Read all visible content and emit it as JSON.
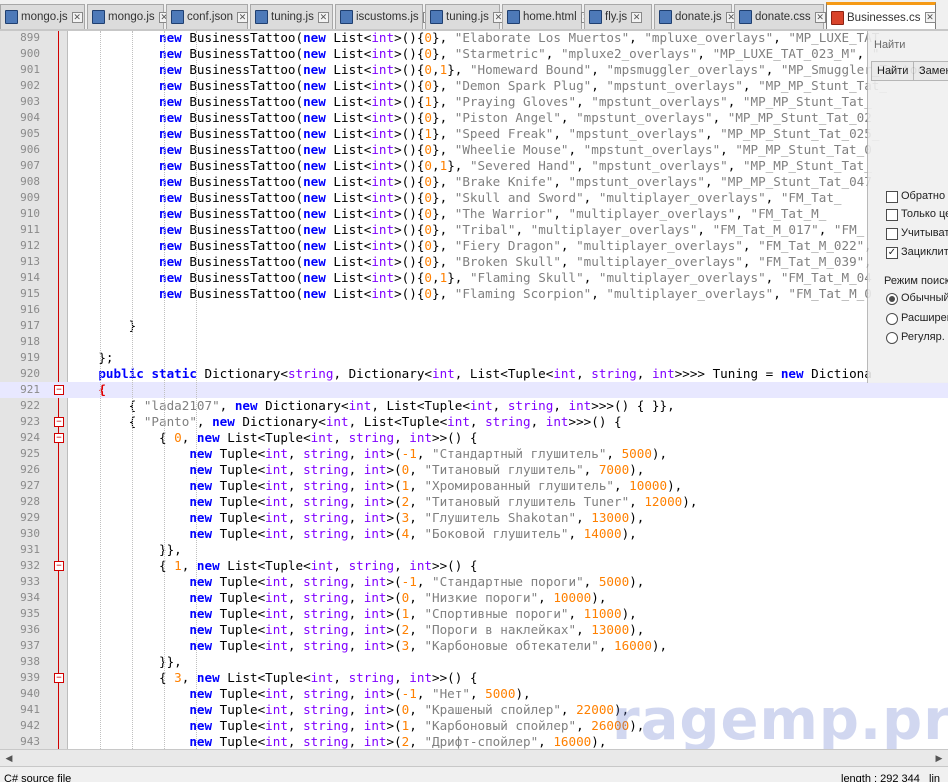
{
  "tabs": [
    {
      "label": "mongo.js",
      "active": false
    },
    {
      "label": "mongo.js",
      "active": false
    },
    {
      "label": "conf.json",
      "active": false
    },
    {
      "label": "tuning.js",
      "active": false
    },
    {
      "label": "iscustoms.js",
      "active": false
    },
    {
      "label": "tuning.js",
      "active": false
    },
    {
      "label": "home.html",
      "active": false
    },
    {
      "label": "fly.js",
      "active": false
    },
    {
      "label": "donate.js",
      "active": false
    },
    {
      "label": "donate.css",
      "active": false
    },
    {
      "label": "Businesses.cs",
      "active": true
    }
  ],
  "tab_close_glyph": "✕",
  "code_lines": [
    {
      "n": "899",
      "text": "            new BusinessTattoo(new List<int>(){0}, \"Elaborate Los Muertos\", \"mpluxe_overlays\", \"MP_LUXE_TAT"
    },
    {
      "n": "900",
      "text": "            new BusinessTattoo(new List<int>(){0}, \"Starmetric\", \"mpluxe2_overlays\", \"MP_LUXE_TAT_023_M\", \""
    },
    {
      "n": "901",
      "text": "            new BusinessTattoo(new List<int>(){0,1}, \"Homeward Bound\", \"mpsmuggler_overlays\", \"MP_Smuggler_Tattoo"
    },
    {
      "n": "902",
      "text": "            new BusinessTattoo(new List<int>(){0}, \"Demon Spark Plug\", \"mpstunt_overlays\", \"MP_MP_Stunt_Tat_"
    },
    {
      "n": "903",
      "text": "            new BusinessTattoo(new List<int>(){1}, \"Praying Gloves\", \"mpstunt_overlays\", \"MP_MP_Stunt_Tat_"
    },
    {
      "n": "904",
      "text": "            new BusinessTattoo(new List<int>(){0}, \"Piston Angel\", \"mpstunt_overlays\", \"MP_MP_Stunt_Tat_02"
    },
    {
      "n": "905",
      "text": "            new BusinessTattoo(new List<int>(){1}, \"Speed Freak\", \"mpstunt_overlays\", \"MP_MP_Stunt_Tat_025_"
    },
    {
      "n": "906",
      "text": "            new BusinessTattoo(new List<int>(){0}, \"Wheelie Mouse\", \"mpstunt_overlays\", \"MP_MP_Stunt_Tat_0"
    },
    {
      "n": "907",
      "text": "            new BusinessTattoo(new List<int>(){0,1}, \"Severed Hand\", \"mpstunt_overlays\", \"MP_MP_Stunt_Tat_"
    },
    {
      "n": "908",
      "text": "            new BusinessTattoo(new List<int>(){0}, \"Brake Knife\", \"mpstunt_overlays\", \"MP_MP_Stunt_Tat_047"
    },
    {
      "n": "909",
      "text": "            new BusinessTattoo(new List<int>(){0}, \"Skull and Sword\", \"multiplayer_overlays\", \"FM_Tat_"
    },
    {
      "n": "910",
      "text": "            new BusinessTattoo(new List<int>(){0}, \"The Warrior\", \"multiplayer_overlays\", \"FM_Tat_M_"
    },
    {
      "n": "911",
      "text": "            new BusinessTattoo(new List<int>(){0}, \"Tribal\", \"multiplayer_overlays\", \"FM_Tat_M_017\", \"FM_"
    },
    {
      "n": "912",
      "text": "            new BusinessTattoo(new List<int>(){0}, \"Fiery Dragon\", \"multiplayer_overlays\", \"FM_Tat_M_022\","
    },
    {
      "n": "913",
      "text": "            new BusinessTattoo(new List<int>(){0}, \"Broken Skull\", \"multiplayer_overlays\", \"FM_Tat_M_039\","
    },
    {
      "n": "914",
      "text": "            new BusinessTattoo(new List<int>(){0,1}, \"Flaming Skull\", \"multiplayer_overlays\", \"FM_Tat_M_04"
    },
    {
      "n": "915",
      "text": "            new BusinessTattoo(new List<int>(){0}, \"Flaming Scorpion\", \"multiplayer_overlays\", \"FM_Tat_M_0"
    },
    {
      "n": "916",
      "text": ""
    },
    {
      "n": "917",
      "text": "        }"
    },
    {
      "n": "918",
      "text": ""
    },
    {
      "n": "919",
      "text": "    };"
    },
    {
      "n": "920",
      "text": "    public static Dictionary<string, Dictionary<int, List<Tuple<int, string, int>>>> Tuning = new Dictiona"
    },
    {
      "n": "921",
      "text": "    {"
    },
    {
      "n": "922",
      "text": "        { \"lada2107\", new Dictionary<int, List<Tuple<int, string, int>>>() { }},"
    },
    {
      "n": "923",
      "text": "        { \"Panto\", new Dictionary<int, List<Tuple<int, string, int>>>() {"
    },
    {
      "n": "924",
      "text": "            { 0, new List<Tuple<int, string, int>>() {"
    },
    {
      "n": "925",
      "text": "                new Tuple<int, string, int>(-1, \"Стандартный глушитель\", 5000),"
    },
    {
      "n": "926",
      "text": "                new Tuple<int, string, int>(0, \"Титановый глушитель\", 7000),"
    },
    {
      "n": "927",
      "text": "                new Tuple<int, string, int>(1, \"Хромированный глушитель\", 10000),"
    },
    {
      "n": "928",
      "text": "                new Tuple<int, string, int>(2, \"Титановый глушитель Tuner\", 12000),"
    },
    {
      "n": "929",
      "text": "                new Tuple<int, string, int>(3, \"Глушитель Shakotan\", 13000),"
    },
    {
      "n": "930",
      "text": "                new Tuple<int, string, int>(4, \"Боковой глушитель\", 14000),"
    },
    {
      "n": "931",
      "text": "            }},"
    },
    {
      "n": "932",
      "text": "            { 1, new List<Tuple<int, string, int>>() {"
    },
    {
      "n": "933",
      "text": "                new Tuple<int, string, int>(-1, \"Стандартные пороги\", 5000),"
    },
    {
      "n": "934",
      "text": "                new Tuple<int, string, int>(0, \"Низкие пороги\", 10000),"
    },
    {
      "n": "935",
      "text": "                new Tuple<int, string, int>(1, \"Спортивные пороги\", 11000),"
    },
    {
      "n": "936",
      "text": "                new Tuple<int, string, int>(2, \"Пороги в наклейках\", 13000),"
    },
    {
      "n": "937",
      "text": "                new Tuple<int, string, int>(3, \"Карбоновые обтекатели\", 16000),"
    },
    {
      "n": "938",
      "text": "            }},"
    },
    {
      "n": "939",
      "text": "            { 3, new List<Tuple<int, string, int>>() {"
    },
    {
      "n": "940",
      "text": "                new Tuple<int, string, int>(-1, \"Нет\", 5000),"
    },
    {
      "n": "941",
      "text": "                new Tuple<int, string, int>(0, \"Крашеный спойлер\", 22000),"
    },
    {
      "n": "942",
      "text": "                new Tuple<int, string, int>(1, \"Карбоновый спойлер\", 26000),"
    },
    {
      "n": "943",
      "text": "                new Tuple<int, string, int>(2, \"Дрифт-спойлер\", 16000),"
    }
  ],
  "current_line": "921",
  "fold_markers": [
    "921",
    "923",
    "924",
    "932",
    "939"
  ],
  "find_panel": {
    "find_label": "Найти",
    "find_button": "Найти",
    "replace_button": "Замен",
    "checkboxes": [
      {
        "label": "Обратно",
        "checked": false
      },
      {
        "label": "Только це",
        "checked": false
      },
      {
        "label": "Учитыват",
        "checked": false
      },
      {
        "label": "Зациклит",
        "checked": true
      }
    ],
    "search_mode_label": "Режим поиск",
    "radios": [
      {
        "label": "Обычный",
        "checked": true
      },
      {
        "label": "Расширен",
        "checked": false
      },
      {
        "label": "Регуляр.",
        "checked": false
      }
    ]
  },
  "status": {
    "file_type": "C# source file",
    "length": "length : 292 344",
    "lines": "lin"
  },
  "watermark": "ragemp.pro",
  "icons": {
    "tab_file": "file-icon",
    "close": "close-icon",
    "fold": "fold-minus-icon",
    "scroll_left": "arrow-left-icon",
    "scroll_right": "arrow-right-icon"
  },
  "colors": {
    "keyword": "#0000ff",
    "type": "#8000ff",
    "string": "#808080",
    "number": "#ff8000",
    "active_tab_accent": "#f59a16",
    "fold_marker": "#d00000",
    "current_line": "#e8e8ff"
  }
}
